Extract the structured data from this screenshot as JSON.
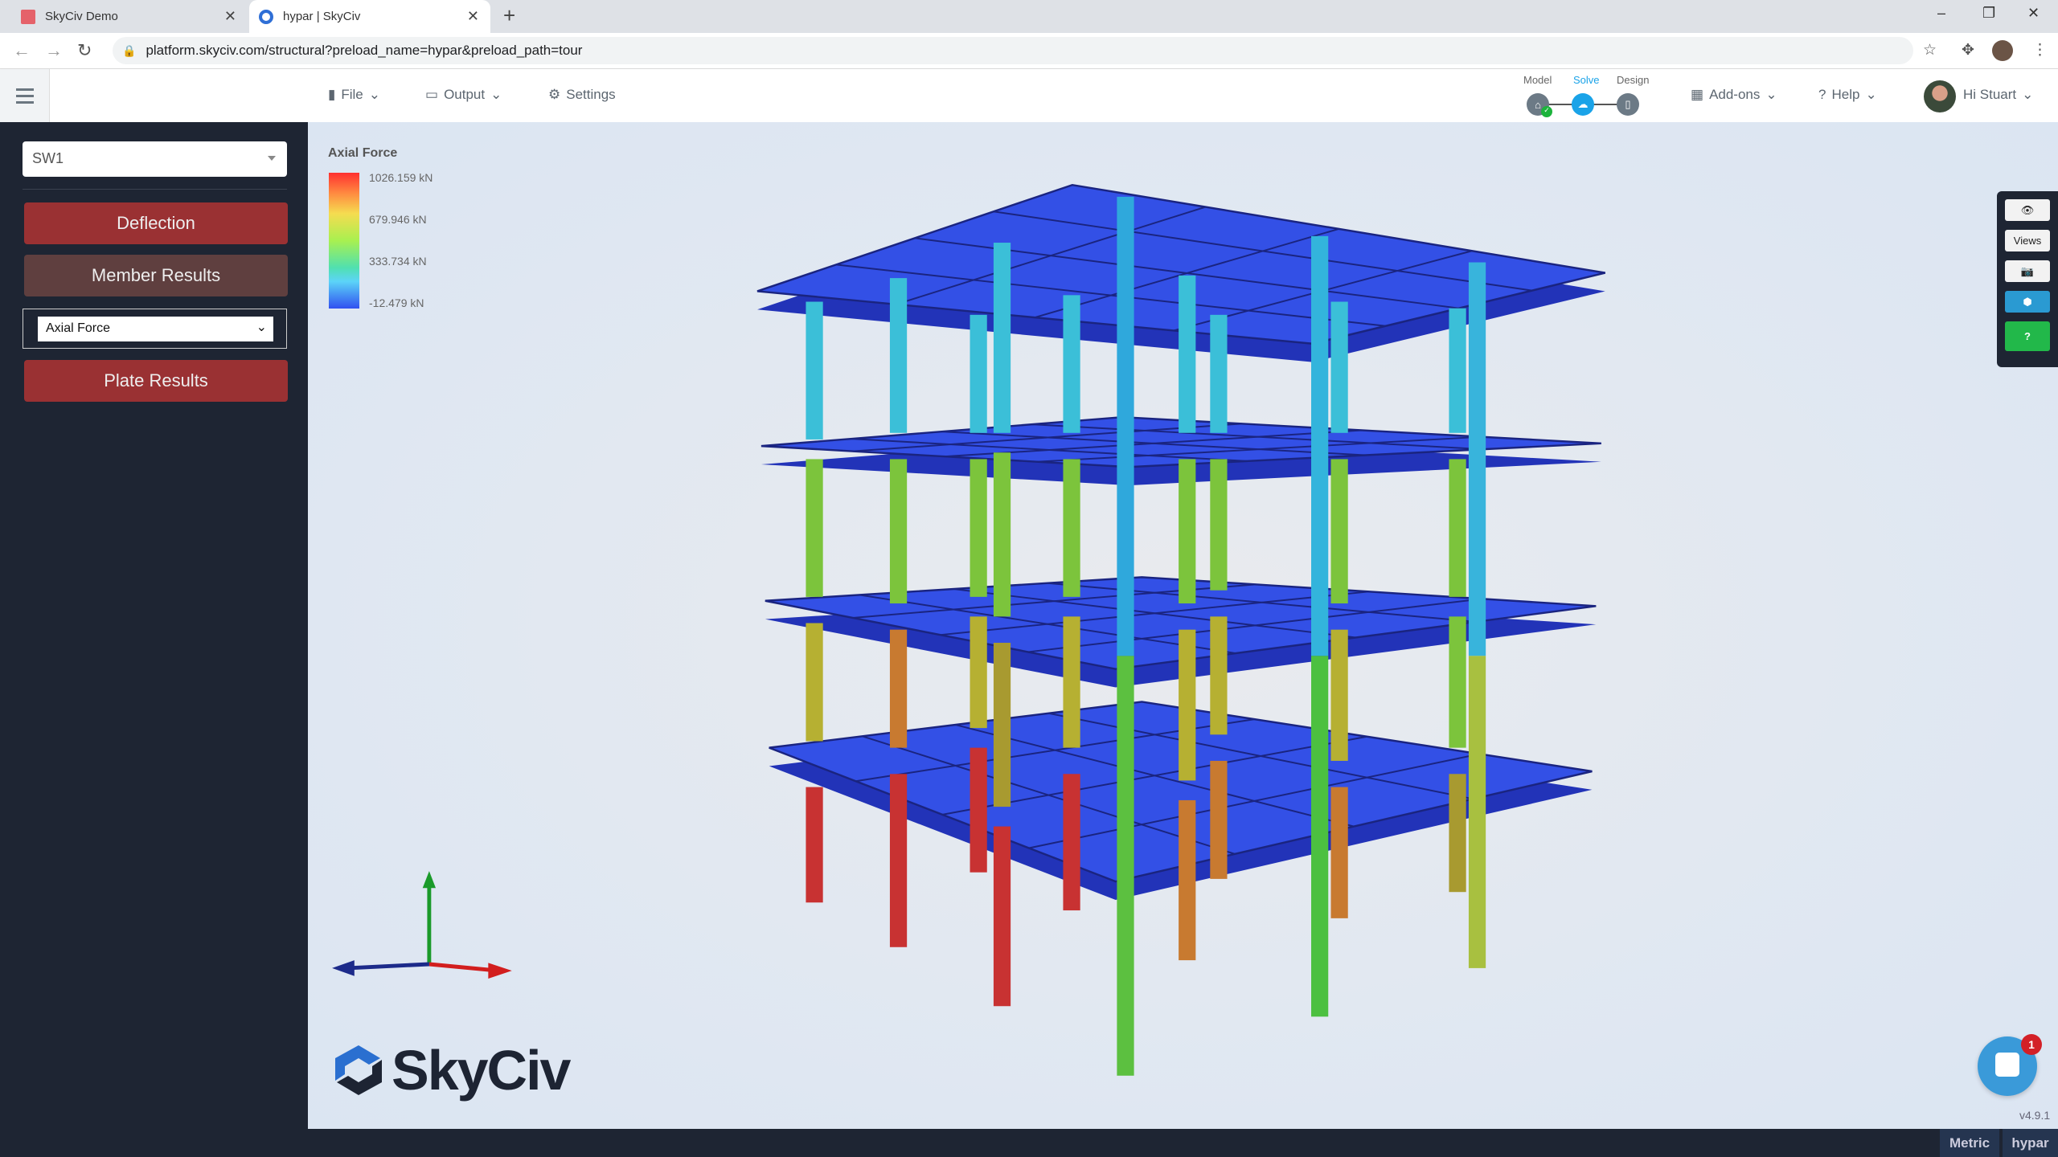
{
  "browser": {
    "tabs": [
      {
        "title": "SkyCiv Demo",
        "active": false
      },
      {
        "title": "hypar | SkyCiv",
        "active": true
      }
    ],
    "url": "platform.skyciv.com/structural?preload_name=hypar&preload_path=tour"
  },
  "header": {
    "menu": [
      {
        "label": "File",
        "icon": "file-icon"
      },
      {
        "label": "Output",
        "icon": "monitor-icon"
      },
      {
        "label": "Settings",
        "icon": "gear-icon"
      }
    ],
    "steps": [
      {
        "label": "Model",
        "state": "done"
      },
      {
        "label": "Solve",
        "state": "active"
      },
      {
        "label": "Design",
        "state": "pending"
      }
    ],
    "addons": "Add-ons",
    "help": "Help",
    "user": "Hi Stuart",
    "accent": "#1aa3e8"
  },
  "sidebar": {
    "load_case": "SW1",
    "deflection": "Deflection",
    "member_results": "Member Results",
    "member_result_type": "Axial Force",
    "plate_results": "Plate Results",
    "button_color": "#9a3133"
  },
  "legend": {
    "title": "Axial Force",
    "labels": [
      "1026.159 kN",
      "679.946 kN",
      "333.734 kN",
      "-12.479 kN"
    ]
  },
  "toolbar": {
    "views": "Views",
    "icons": [
      "eye-icon",
      "camera-icon",
      "cube-icon",
      "help-icon"
    ]
  },
  "logo": "SkyCiv",
  "chat": {
    "badge": "1"
  },
  "version": "v4.9.1",
  "status": {
    "units": "Metric",
    "project": "hypar"
  }
}
